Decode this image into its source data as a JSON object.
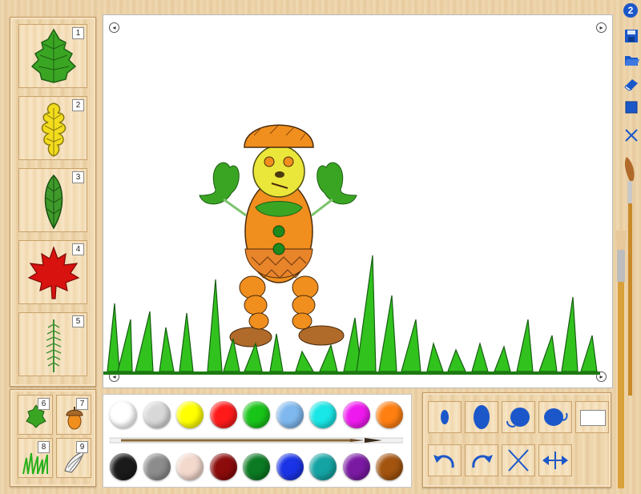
{
  "leaf_panel": {
    "items": [
      {
        "number": "1",
        "icon": "birch-leaf-icon",
        "color": "#3aa523"
      },
      {
        "number": "2",
        "icon": "oak-leaf-icon",
        "color": "#f2dc1d"
      },
      {
        "number": "3",
        "icon": "elm-leaf-icon",
        "color": "#3f9a2b"
      },
      {
        "number": "4",
        "icon": "maple-leaf-icon",
        "color": "#d8120e"
      },
      {
        "number": "5",
        "icon": "fir-twig-icon",
        "color": "#3e8f34"
      }
    ]
  },
  "small_panel": {
    "items": [
      {
        "number": "6",
        "icon": "small-leaf-icon"
      },
      {
        "number": "7",
        "icon": "acorn-icon"
      },
      {
        "number": "8",
        "icon": "grass-icon"
      },
      {
        "number": "9",
        "icon": "shell-icon"
      }
    ]
  },
  "palette": {
    "top_row": [
      "#ffffff",
      "#d8d8d8",
      "#ffff00",
      "#ff1a1a",
      "#19c419",
      "#7fb8ee",
      "#19e6e6",
      "#ee19ee",
      "#ff7f11"
    ],
    "bottom_row": [
      "#1a1a1a",
      "#8c8c8c",
      "#f3d8cc",
      "#8c0b0b",
      "#0b7a23",
      "#1a33e6",
      "#14a3a3",
      "#7a1aa3",
      "#a3540f"
    ]
  },
  "tools": {
    "top_row": [
      "small-brush-size-icon",
      "large-brush-size-icon",
      "rotate-left-shape-icon",
      "rotate-right-shape-icon",
      "color-preview-icon"
    ],
    "bottom_row": [
      "undo-arrow-icon",
      "redo-arrow-icon",
      "cross-delete-icon",
      "flip-horizontal-icon"
    ]
  },
  "sidebar": {
    "badge": "2",
    "buttons": [
      "save-icon",
      "open-folder-icon",
      "eraser-icon",
      "new-page-icon",
      "close-icon"
    ]
  },
  "colors": {
    "accent": "#1b57c9",
    "wood": "#ecd3a8"
  }
}
